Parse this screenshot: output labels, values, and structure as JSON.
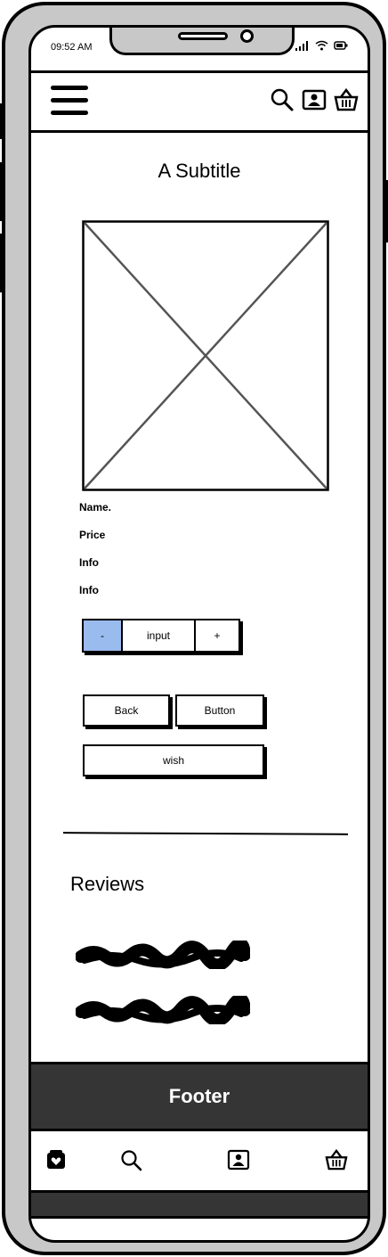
{
  "status_bar": {
    "time": "09:52 AM"
  },
  "header": {
    "icons": [
      "menu-icon",
      "search-icon",
      "account-icon",
      "basket-icon"
    ]
  },
  "main": {
    "subtitle": "A Subtitle",
    "product": {
      "name": "Name.",
      "price": "Price",
      "info_1": "Info",
      "info_2": "Info"
    },
    "quantity": {
      "minus": "-",
      "input": "input",
      "plus": "+"
    },
    "buttons": {
      "back": "Back",
      "button": "Button",
      "wish": "wish"
    }
  },
  "reviews": {
    "title": "Reviews"
  },
  "footer": {
    "label": "Footer"
  },
  "tabbar": {
    "icons": [
      "shop-icon",
      "search-icon",
      "account-icon",
      "basket-icon"
    ]
  },
  "colors": {
    "accent": "#99bbee",
    "footer_bg": "#353535",
    "frame": "#c8c8c8"
  }
}
